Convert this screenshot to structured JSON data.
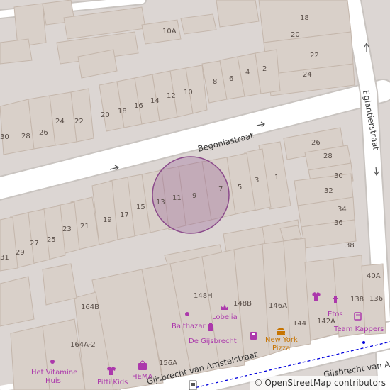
{
  "streets": {
    "begonia": "Begoniastraat",
    "eglantier": "Eglantierstraat",
    "gijsbrecht_right": "Gijsbrecht van Amstel",
    "gijsbrecht_left": "Gijsbrecht van Amstelstraat"
  },
  "house_numbers": {
    "top_row": [
      "18",
      "10A",
      "20",
      "22",
      "8",
      "6",
      "4",
      "2",
      "24"
    ],
    "middle_row": [
      "30",
      "28",
      "26",
      "24",
      "22",
      "20",
      "18",
      "16",
      "14",
      "12",
      "10"
    ],
    "block": [
      "26",
      "28",
      "30",
      "32",
      "34",
      "36",
      "38",
      "40A",
      "1",
      "3",
      "5",
      "7",
      "9",
      "11",
      "13",
      "15",
      "17",
      "19",
      "21",
      "23",
      "25",
      "27",
      "29",
      "31"
    ],
    "bottom": [
      "148H",
      "148B",
      "146A",
      "164B",
      "144",
      "142A",
      "138",
      "136",
      "164A-2",
      "156A"
    ]
  },
  "pois": {
    "balthazar": "Balthazar",
    "lobelia": "Lobelia",
    "etos": "Etos",
    "team_kappers": "Team Kappers",
    "de_gijsbrecht": "De Gijsbrecht",
    "new_york_pizza": "New York Pizza",
    "het_vitamine_huis": "Het Vitamine Huis",
    "pitti_kids": "Pitti Kids",
    "hema": "HEMA"
  },
  "attribution": {
    "symbol": "©",
    "text": "OpenStreetMap contributors"
  },
  "colors": {
    "poi_purple": "#ac39ac",
    "poi_orange": "#c77400",
    "highlight_circle": "#8b4a8b",
    "route": "#0000dd"
  }
}
